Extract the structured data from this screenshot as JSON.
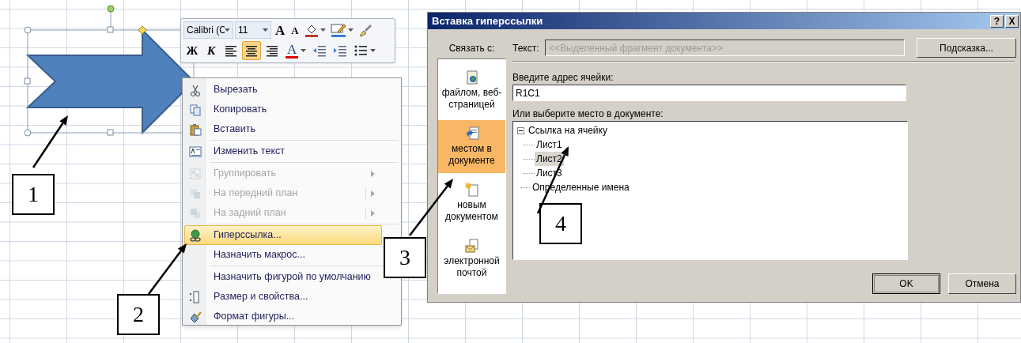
{
  "mini_toolbar": {
    "font": "Calibri (C",
    "size": "11",
    "row_1": [
      {
        "kind": "grow",
        "label": "A"
      },
      {
        "kind": "shrink",
        "label": "A"
      },
      {
        "kind": "fill"
      },
      {
        "kind": "outline"
      },
      {
        "kind": "painter"
      }
    ],
    "row_2": [
      {
        "kind": "bold",
        "label": "Ж",
        "selected": false
      },
      {
        "kind": "italic",
        "label": "К",
        "selected": false
      },
      {
        "kind": "align-left",
        "selected": false
      },
      {
        "kind": "align-center",
        "selected": true
      },
      {
        "kind": "align-right",
        "selected": false
      },
      {
        "kind": "font-color",
        "label": "A",
        "selected": false
      },
      {
        "kind": "outdent",
        "selected": false
      },
      {
        "kind": "indent",
        "selected": false
      },
      {
        "kind": "bullets",
        "selected": false
      }
    ]
  },
  "context_menu": {
    "groups": [
      [
        {
          "label": "Вырезать",
          "disabled": false,
          "submenu": false,
          "selected": false
        },
        {
          "label": "Копировать",
          "disabled": false,
          "submenu": false,
          "selected": false
        },
        {
          "label": "Вставить",
          "disabled": false,
          "submenu": false,
          "selected": false
        }
      ],
      [
        {
          "label": "Изменить текст",
          "disabled": false,
          "submenu": false,
          "selected": false
        }
      ],
      [
        {
          "label": "Группировать",
          "disabled": true,
          "submenu": true,
          "selected": false
        },
        {
          "label": "На передний план",
          "disabled": true,
          "submenu": true,
          "selected": false
        },
        {
          "label": "На задний план",
          "disabled": true,
          "submenu": true,
          "selected": false
        }
      ],
      [
        {
          "label": "Гиперссылка...",
          "disabled": false,
          "submenu": false,
          "selected": true
        },
        {
          "label": "Назначить макрос...",
          "disabled": false,
          "submenu": false,
          "selected": false
        }
      ],
      [
        {
          "label": "Назначить фигурой по умолчанию",
          "disabled": false,
          "submenu": false,
          "selected": false
        },
        {
          "label": "Размер и свойства...",
          "disabled": false,
          "submenu": false,
          "selected": false
        },
        {
          "label": "Формат фигуры...",
          "disabled": false,
          "submenu": false,
          "selected": false
        }
      ]
    ]
  },
  "dialog": {
    "title": "Вставка гиперссылки",
    "title_buttons": [
      "?",
      "X"
    ],
    "link_to": {
      "label": "Связать с:",
      "items": [
        {
          "label": "файлом, веб-страницей",
          "selected": false
        },
        {
          "label": "местом в документе",
          "selected": true
        },
        {
          "label": "новым документом",
          "selected": false
        },
        {
          "label": "электронной почтой",
          "selected": false
        }
      ]
    },
    "text": {
      "label": "Текст:",
      "value": "<<Выделенный фрагмент документа>>",
      "disabled": true
    },
    "hint_button": "Подсказка...",
    "address": {
      "label": "Введите адрес ячейки:",
      "value": "R1C1"
    },
    "place": {
      "label": "Или выберите место в документе:",
      "tree": [
        {
          "label": "Ссылка на ячейку",
          "selected": false,
          "expanded": true,
          "children": [
            {
              "label": "Лист1",
              "selected": false
            },
            {
              "label": "Лист2",
              "selected": true
            },
            {
              "label": "Лист3",
              "selected": false
            }
          ]
        },
        {
          "label": "Определенные имена",
          "selected": false
        }
      ]
    },
    "buttons": [
      "OK",
      "Отмена"
    ]
  },
  "callouts": [
    "1",
    "2",
    "3",
    "4"
  ]
}
